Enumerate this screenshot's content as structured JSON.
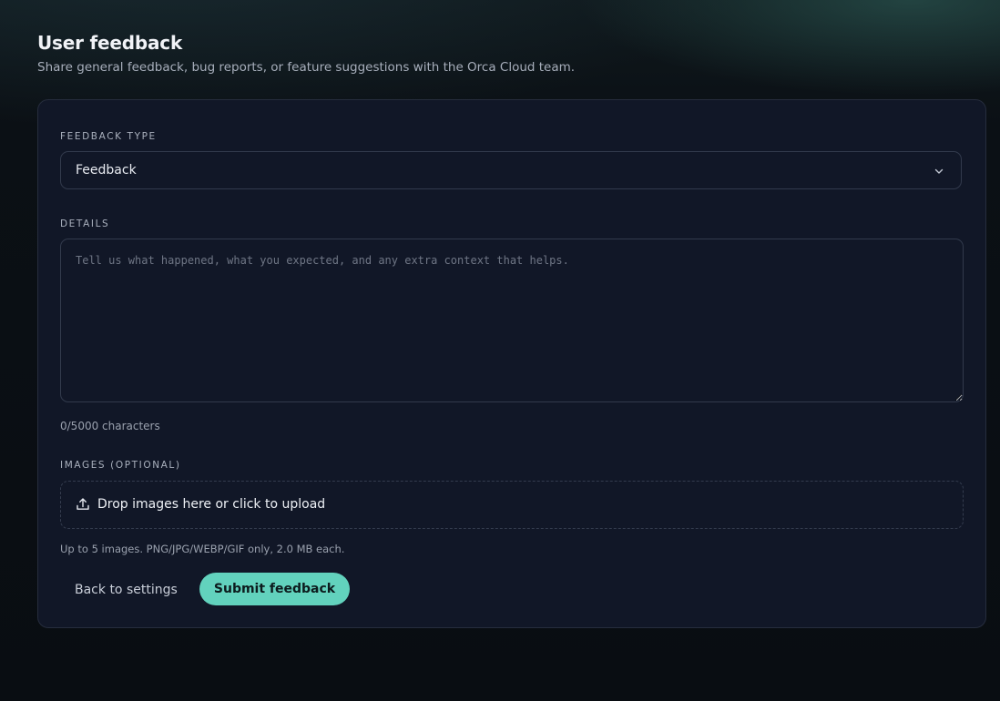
{
  "header": {
    "title": "User feedback",
    "subtitle": "Share general feedback, bug reports, or feature suggestions with the Orca Cloud team."
  },
  "form": {
    "feedback_type": {
      "label": "FEEDBACK TYPE",
      "selected": "Feedback"
    },
    "details": {
      "label": "DETAILS",
      "placeholder": "Tell us what happened, what you expected, and any extra context that helps.",
      "value": "",
      "char_count": "0/5000 characters"
    },
    "images": {
      "label": "IMAGES (OPTIONAL)",
      "dropzone_text": "Drop images here or click to upload",
      "hint": "Up to 5 images. PNG/JPG/WEBP/GIF only, 2.0 MB each."
    },
    "actions": {
      "back_label": "Back to settings",
      "submit_label": "Submit feedback"
    }
  },
  "theme": {
    "accent": "#62d2bd",
    "card_bg": "#111727",
    "border": "#323a4c"
  },
  "icons": {
    "select": "chevron-down-icon",
    "upload": "upload-icon"
  }
}
